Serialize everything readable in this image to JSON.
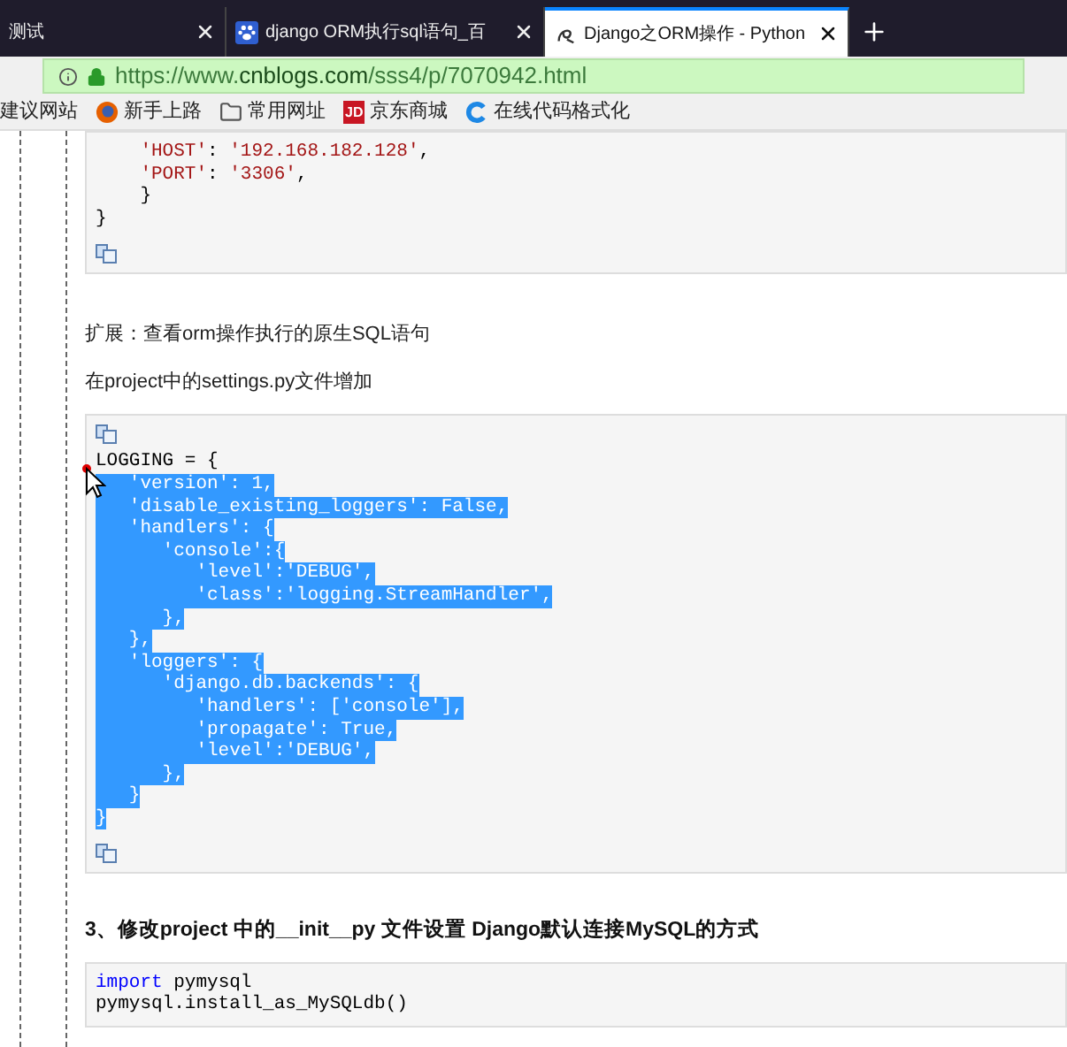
{
  "tabs": [
    {
      "title": "测试",
      "selected": false
    },
    {
      "title": "django ORM执行sql语句_百",
      "selected": false
    },
    {
      "title": "Django之ORM操作 - Python",
      "selected": true
    }
  ],
  "address_bar": {
    "url_prefix": "https://www.",
    "url_domain": "cnblogs.com",
    "url_path": "/sss4/p/7070942.html"
  },
  "bookmarks": [
    {
      "label": "建议网站"
    },
    {
      "label": "新手上路"
    },
    {
      "label": "常用网址"
    },
    {
      "label": "京东商城",
      "badge": "JD"
    },
    {
      "label": "在线代码格式化"
    }
  ],
  "content": [
    {
      "kind": "code",
      "copy_top": false,
      "copy_bottom": true,
      "lines": [
        [
          {
            "text": "    'HOST'",
            "kind": "str"
          },
          {
            "text": ": ",
            "kind": "plain"
          },
          {
            "text": "'192.168.182.128'",
            "kind": "str"
          },
          {
            "text": ",",
            "kind": "plain"
          }
        ],
        [
          {
            "text": "    'PORT'",
            "kind": "str"
          },
          {
            "text": ": ",
            "kind": "plain"
          },
          {
            "text": "'3306'",
            "kind": "str"
          },
          {
            "text": ",",
            "kind": "plain"
          }
        ],
        [
          {
            "text": "    }",
            "kind": "plain"
          }
        ],
        [
          {
            "text": "}",
            "kind": "plain"
          }
        ]
      ],
      "selected": [
        false,
        false,
        false,
        false
      ]
    },
    {
      "kind": "para",
      "text": "扩展：查看orm操作执行的原生SQL语句"
    },
    {
      "kind": "para",
      "text": "在project中的settings.py文件增加"
    },
    {
      "kind": "code",
      "copy_top": true,
      "copy_bottom": true,
      "lines": [
        [
          {
            "text": "LOGGING = {",
            "kind": "plain"
          }
        ],
        [
          {
            "text": "   'version': 1,",
            "kind": "plain"
          }
        ],
        [
          {
            "text": "   'disable_existing_loggers': False,",
            "kind": "plain"
          }
        ],
        [
          {
            "text": "   'handlers': {",
            "kind": "plain"
          }
        ],
        [
          {
            "text": "      'console':{",
            "kind": "plain"
          }
        ],
        [
          {
            "text": "         'level':'DEBUG',",
            "kind": "plain"
          }
        ],
        [
          {
            "text": "         'class':'logging.StreamHandler',",
            "kind": "plain"
          }
        ],
        [
          {
            "text": "      },",
            "kind": "plain"
          }
        ],
        [
          {
            "text": "   },",
            "kind": "plain"
          }
        ],
        [
          {
            "text": "   'loggers': {",
            "kind": "plain"
          }
        ],
        [
          {
            "text": "      'django.db.backends': {",
            "kind": "plain"
          }
        ],
        [
          {
            "text": "         'handlers': ['console'],",
            "kind": "plain"
          }
        ],
        [
          {
            "text": "         'propagate': True,",
            "kind": "plain"
          }
        ],
        [
          {
            "text": "         'level':'DEBUG',",
            "kind": "plain"
          }
        ],
        [
          {
            "text": "      },",
            "kind": "plain"
          }
        ],
        [
          {
            "text": "   }",
            "kind": "plain"
          }
        ],
        [
          {
            "text": "}",
            "kind": "plain"
          }
        ]
      ],
      "selected": [
        false,
        true,
        true,
        true,
        true,
        true,
        true,
        true,
        true,
        true,
        true,
        true,
        true,
        true,
        true,
        true,
        true
      ]
    },
    {
      "kind": "heading",
      "text": "3、修改project 中的__init__py 文件设置 Django默认连接MySQL的方式"
    },
    {
      "kind": "code",
      "copy_top": false,
      "copy_bottom": false,
      "lines": [
        [
          {
            "text": "import",
            "kind": "kw"
          },
          {
            "text": " pymysql",
            "kind": "plain"
          }
        ],
        [
          {
            "text": "pymysql.install_as_MySQLdb()",
            "kind": "plain"
          }
        ]
      ],
      "selected": [
        false,
        false
      ]
    }
  ]
}
